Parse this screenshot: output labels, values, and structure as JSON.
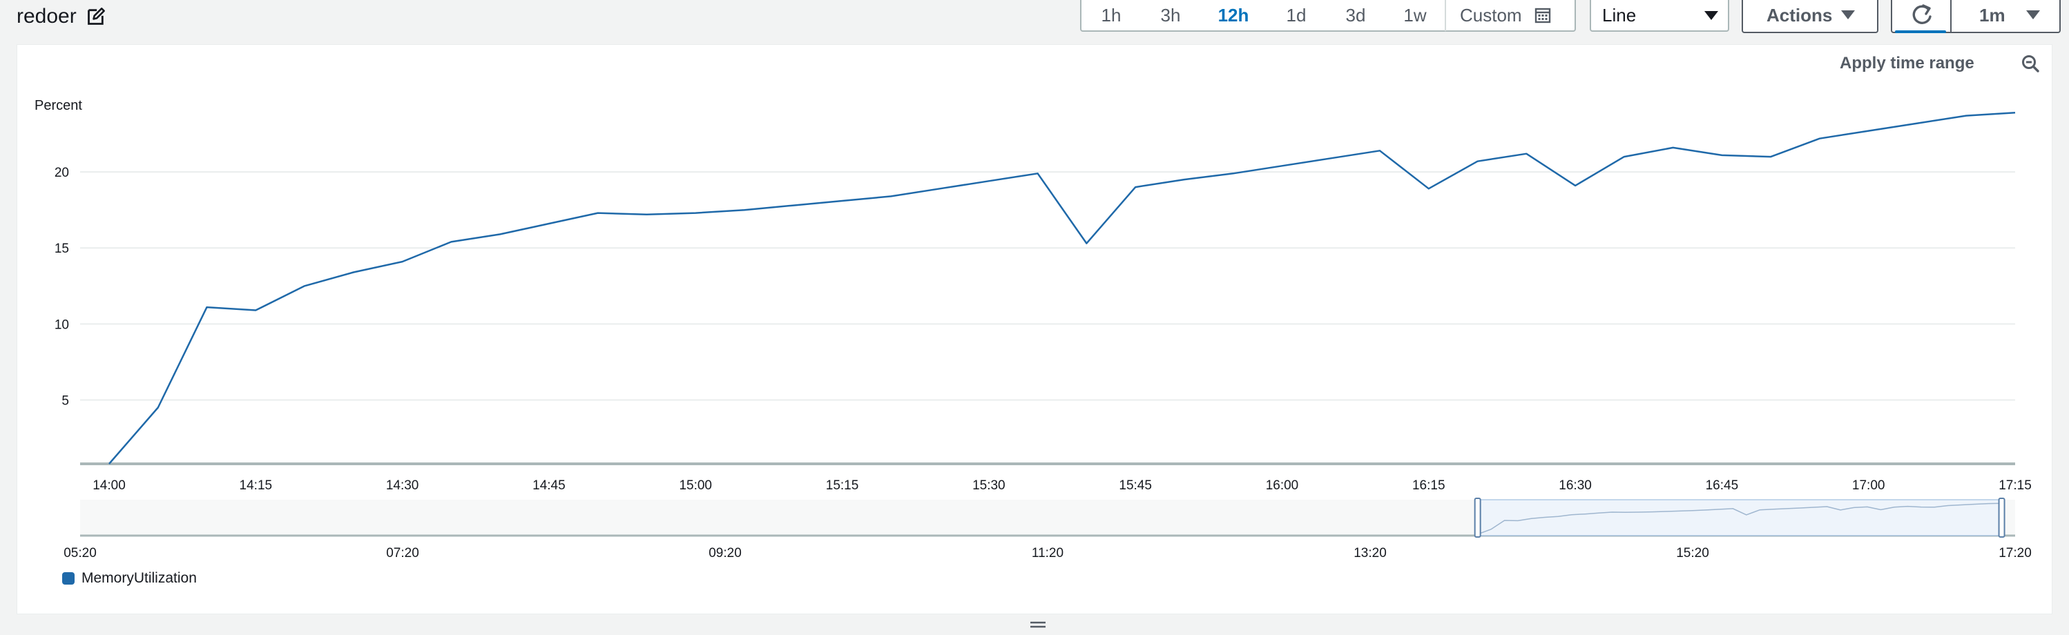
{
  "widget": {
    "title": "redoer"
  },
  "toolbar": {
    "time_ranges": [
      "1h",
      "3h",
      "12h",
      "1d",
      "3d",
      "1w"
    ],
    "active_time_range": "12h",
    "custom_label": "Custom",
    "chart_type_select": "Line",
    "actions_label": "Actions",
    "refresh_interval": "1m"
  },
  "graph": {
    "apply_time_range_label": "Apply time range",
    "legend": [
      "MemoryUtilization"
    ]
  },
  "colors": {
    "series": "#1f69a9",
    "accent": "#0073bb",
    "navigator_fill": "#eef4fb"
  },
  "chart_data": {
    "type": "line",
    "ylabel": "Percent",
    "yticks": [
      "5",
      "10",
      "15",
      "20"
    ],
    "ylim": [
      0.8,
      24.5
    ],
    "grid": true,
    "legend_position": "bottom-left",
    "xticks": [
      "14:00",
      "14:15",
      "14:30",
      "14:45",
      "15:00",
      "15:15",
      "15:30",
      "15:45",
      "16:00",
      "16:15",
      "16:30",
      "16:45",
      "17:00",
      "17:15"
    ],
    "series": [
      {
        "name": "MemoryUtilization",
        "x": [
          "14:00",
          "14:05",
          "14:10",
          "14:15",
          "14:20",
          "14:25",
          "14:30",
          "14:35",
          "14:40",
          "14:45",
          "14:50",
          "14:55",
          "15:00",
          "15:05",
          "15:10",
          "15:15",
          "15:20",
          "15:25",
          "15:30",
          "15:35",
          "15:40",
          "15:45",
          "15:50",
          "15:55",
          "16:00",
          "16:05",
          "16:10",
          "16:15",
          "16:20",
          "16:25",
          "16:30",
          "16:35",
          "16:40",
          "16:45",
          "16:50",
          "16:55",
          "17:00",
          "17:05",
          "17:10",
          "17:15"
        ],
        "values": [
          0.8,
          4.5,
          11.1,
          10.9,
          12.5,
          13.4,
          14.1,
          15.4,
          15.9,
          16.6,
          17.3,
          17.2,
          17.3,
          17.5,
          17.8,
          18.1,
          18.4,
          18.9,
          19.4,
          19.9,
          15.3,
          19.0,
          19.5,
          19.9,
          20.4,
          20.9,
          21.4,
          18.9,
          20.7,
          21.2,
          19.1,
          21.0,
          21.6,
          21.1,
          21.0,
          22.2,
          22.7,
          23.2,
          23.7,
          23.9
        ]
      }
    ],
    "navigator": {
      "xticks": [
        "05:20",
        "07:20",
        "09:20",
        "11:20",
        "13:20",
        "15:20",
        "17:20"
      ],
      "selection": [
        "14:00",
        "17:15"
      ]
    }
  }
}
